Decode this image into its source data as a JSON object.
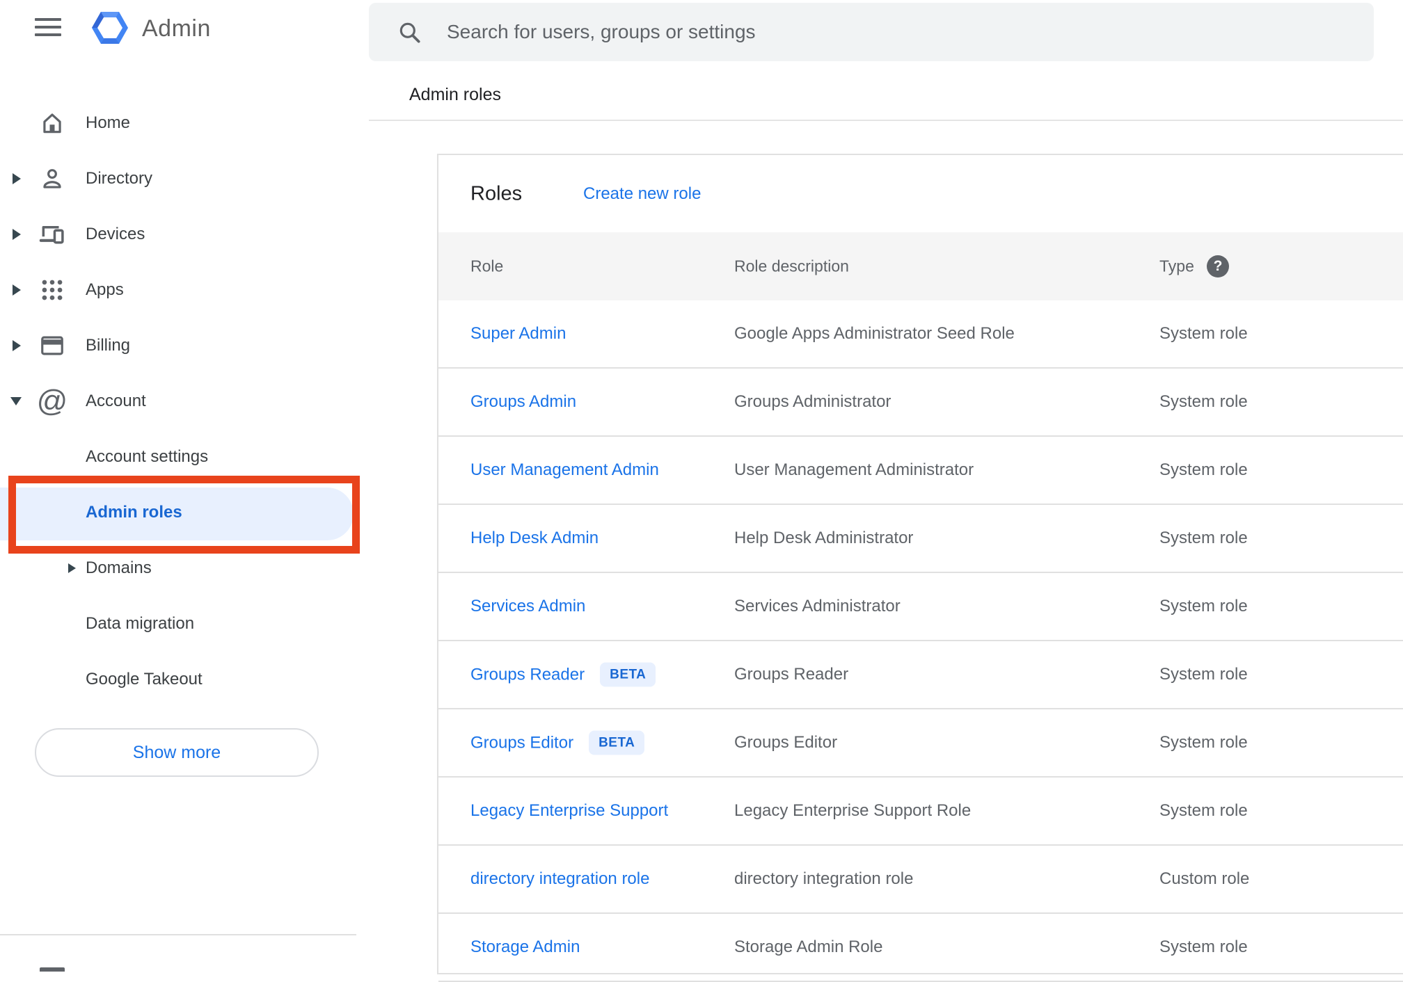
{
  "header": {
    "app_title": "Admin",
    "search_placeholder": "Search for users, groups or settings"
  },
  "breadcrumb": "Admin roles",
  "sidebar": {
    "items": [
      {
        "label": "Home"
      },
      {
        "label": "Directory"
      },
      {
        "label": "Devices"
      },
      {
        "label": "Apps"
      },
      {
        "label": "Billing"
      },
      {
        "label": "Account"
      },
      {
        "label": "Account settings"
      },
      {
        "label": "Admin roles"
      },
      {
        "label": "Domains"
      },
      {
        "label": "Data migration"
      },
      {
        "label": "Google Takeout"
      }
    ],
    "show_more_label": "Show more"
  },
  "main": {
    "card_title": "Roles",
    "create_link": "Create new role",
    "beta_label": "BETA",
    "help_glyph": "?",
    "columns": {
      "role": "Role",
      "description": "Role description",
      "type": "Type"
    },
    "rows": [
      {
        "role": "Super Admin",
        "description": "Google Apps Administrator Seed Role",
        "type": "System role"
      },
      {
        "role": "Groups Admin",
        "description": "Groups Administrator",
        "type": "System role"
      },
      {
        "role": "User Management Admin",
        "description": "User Management Administrator",
        "type": "System role"
      },
      {
        "role": "Help Desk Admin",
        "description": "Help Desk Administrator",
        "type": "System role"
      },
      {
        "role": "Services Admin",
        "description": "Services Administrator",
        "type": "System role"
      },
      {
        "role": "Groups Reader",
        "beta": true,
        "description": "Groups Reader",
        "type": "System role"
      },
      {
        "role": "Groups Editor",
        "beta": true,
        "description": "Groups Editor",
        "type": "System role"
      },
      {
        "role": "Legacy Enterprise Support",
        "description": "Legacy Enterprise Support Role",
        "type": "System role"
      },
      {
        "role": "directory integration role",
        "description": "directory integration role",
        "type": "Custom role"
      },
      {
        "role": "Storage Admin",
        "description": "Storage Admin Role",
        "type": "System role"
      }
    ]
  },
  "colors": {
    "accent_blue": "#1a73e8",
    "selected_blue": "#1967d2",
    "badge_bg": "#e8f0fe",
    "annotation_red": "#e8431c",
    "search_bg": "#f1f3f4",
    "table_header_bg": "#f5f5f5",
    "border_gray": "#e0e0e0",
    "text_primary": "#202124",
    "text_secondary": "#5f6368"
  }
}
